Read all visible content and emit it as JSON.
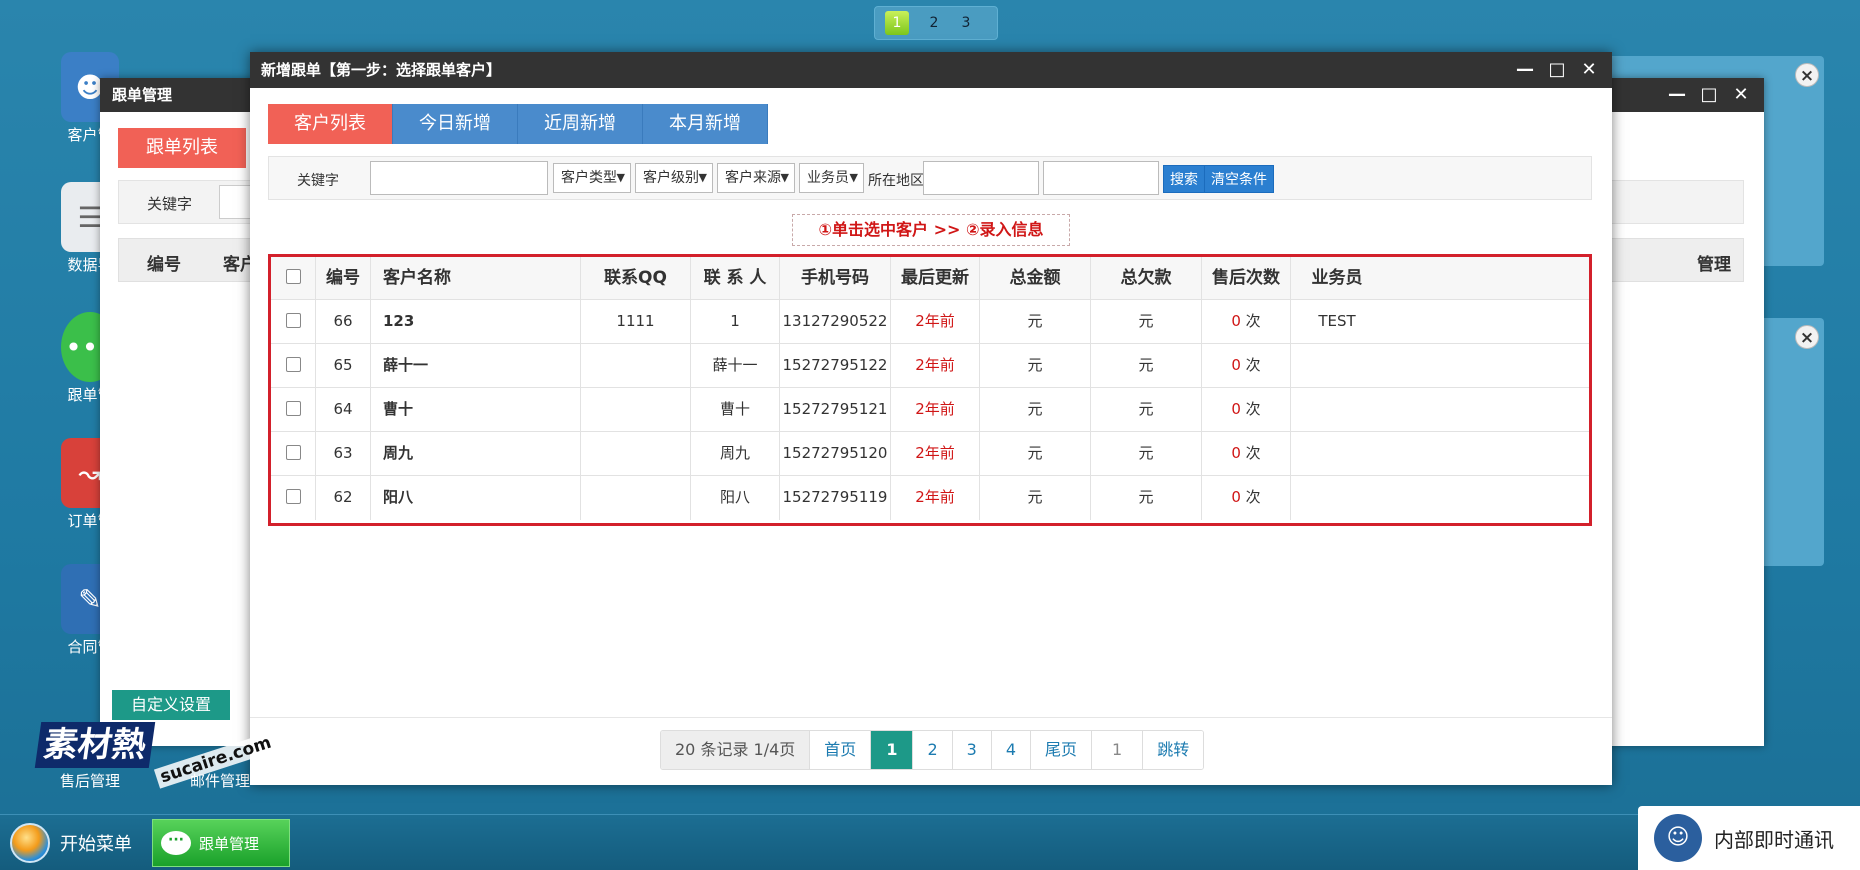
{
  "desktop": {
    "pager": [
      "1",
      "2",
      "3"
    ],
    "icons": [
      {
        "label": "客户管",
        "icon": "customers-icon",
        "color": "#3b7fc6"
      },
      {
        "label": "数据导",
        "icon": "document-icon",
        "color": "#e9ecef"
      },
      {
        "label": "跟单管",
        "icon": "chat-bubble-icon",
        "color": "#3bbf4a"
      },
      {
        "label": "订单管",
        "icon": "chart-icon",
        "color": "#d8413a"
      },
      {
        "label": "合同管",
        "icon": "contract-icon",
        "color": "#2f6fb4"
      },
      {
        "label": "售后管理",
        "icon": "service-icon",
        "color": "#f1a63b"
      },
      {
        "label": "邮件管理",
        "icon": "mail-icon",
        "color": "#d0342c"
      }
    ]
  },
  "back_window": {
    "title": "跟单管理",
    "tab": "跟单列表",
    "keyword_label": "关键字",
    "columns": [
      "编号",
      "客户",
      "管理"
    ],
    "custom_button": "自定义设置"
  },
  "front_window": {
    "title": "新增跟单【第一步：选择跟单客户】",
    "tabs": [
      "客户列表",
      "今日新增",
      "近周新增",
      "本月新增"
    ],
    "search": {
      "keyword_label": "关键字",
      "keyword_value": "",
      "selects": [
        "客户类型",
        "客户级别",
        "客户来源",
        "业务员"
      ],
      "region_label": "所在地区",
      "search_button": "搜索",
      "clear_button": "清空条件"
    },
    "hint": "①单击选中客户 >> ②录入信息",
    "table": {
      "columns": [
        "编号",
        "客户名称",
        "联系QQ",
        "联 系 人",
        "手机号码",
        "最后更新",
        "总金额",
        "总欠款",
        "售后次数",
        "业务员"
      ],
      "rows": [
        {
          "id": "66",
          "name": "123",
          "qq": "1111",
          "contact": "1",
          "phone": "13127290522",
          "updated": "2年前",
          "total": "元",
          "debt": "元",
          "service_count": "0",
          "service_unit": "次",
          "staff": "TEST"
        },
        {
          "id": "65",
          "name": "薛十一",
          "qq": "",
          "contact": "薛十一",
          "phone": "15272795122",
          "updated": "2年前",
          "total": "元",
          "debt": "元",
          "service_count": "0",
          "service_unit": "次",
          "staff": ""
        },
        {
          "id": "64",
          "name": "曹十",
          "qq": "",
          "contact": "曹十",
          "phone": "15272795121",
          "updated": "2年前",
          "total": "元",
          "debt": "元",
          "service_count": "0",
          "service_unit": "次",
          "staff": ""
        },
        {
          "id": "63",
          "name": "周九",
          "qq": "",
          "contact": "周九",
          "phone": "15272795120",
          "updated": "2年前",
          "total": "元",
          "debt": "元",
          "service_count": "0",
          "service_unit": "次",
          "staff": ""
        },
        {
          "id": "62",
          "name": "阳八",
          "qq": "",
          "contact": "阳八",
          "phone": "15272795119",
          "updated": "2年前",
          "total": "元",
          "debt": "元",
          "service_count": "0",
          "service_unit": "次",
          "staff": ""
        }
      ]
    },
    "pagination": {
      "info": "20 条记录 1/4页",
      "first": "首页",
      "pages": [
        "1",
        "2",
        "3",
        "4"
      ],
      "current": "1",
      "last": "尾页",
      "jump_value": "1",
      "jump": "跳转"
    }
  },
  "taskbar": {
    "start": "开始菜单",
    "task": "跟单管理",
    "im": "内部即时通讯"
  },
  "watermark": {
    "big": "素材熱",
    "small": "sucaire.com"
  },
  "colors": {
    "accent_red": "#f16156",
    "tab_blue": "#4a8bcc",
    "teal": "#1d9988",
    "highlight_red": "#d3202b"
  }
}
